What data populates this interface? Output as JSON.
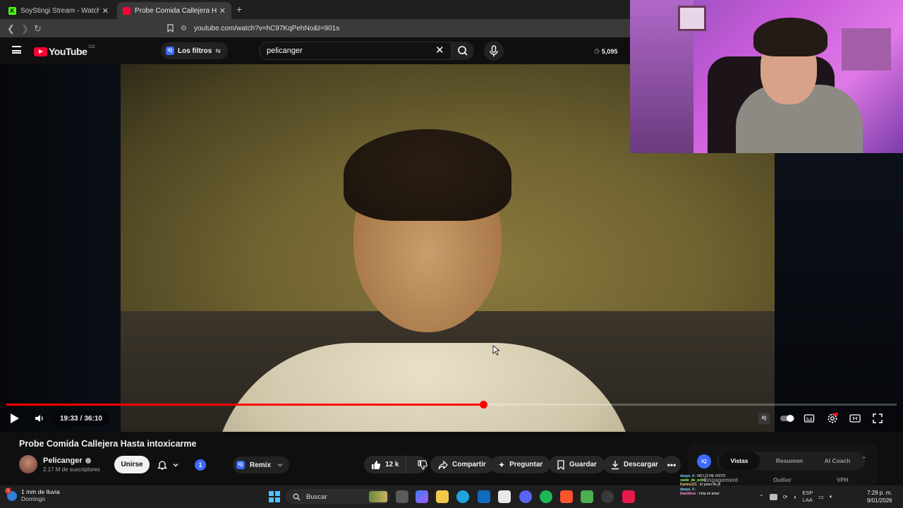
{
  "browser": {
    "tabs": [
      {
        "label": "SoyStingi Stream - Watch Live on Kick",
        "favicon": "K"
      },
      {
        "label": "Probe Comida Callejera Hasta intoxicarme"
      }
    ],
    "new_tab": "+",
    "url": "youtube.com/watch?v=hC97KqPehNo&t=901s"
  },
  "youtube": {
    "logo_text": "YouTube",
    "logo_region": "CO",
    "filters_label": "Los filtros",
    "filters_badge": "IQ",
    "search_value": "pelicanger",
    "view_count": "5,095"
  },
  "player": {
    "progress_fraction": 0.536,
    "current_time": "19:33",
    "separator": "/",
    "duration": "36:10"
  },
  "video_info": {
    "title": "Probe Comida Callejera Hasta intoxicarme",
    "channel_name": "Pelicanger",
    "subscribers": "2.17 M de suscriptores",
    "join_label": "Unirse",
    "notif_count": "1",
    "remix_label": "Remix",
    "remix_badge": "IQ",
    "likes": "12 k",
    "share_label": "Compartir",
    "ask_label": "Preguntar",
    "save_label": "Guardar",
    "download_label": "Descargar",
    "more_label": "•••"
  },
  "iq_panel": {
    "logo": "IQ",
    "tabs": [
      "Vistas",
      "Resumen",
      "AI Coach"
    ],
    "active_tab": "Vistas",
    "columns": [
      "Engagement",
      "Outlier",
      "VPH"
    ]
  },
  "chat": [
    {
      "user": "daaya_4 :",
      "msg": "NO LO HE VISTO"
    },
    {
      "user": "valde_de_pollo :",
      "msg": ""
    },
    {
      "user": "Darkis221 :",
      "msg": "El pene de jh"
    },
    {
      "user": "daaya_4 :",
      "msg": ""
    },
    {
      "user": "Davidlzzz :",
      "msg": "hola mi amor"
    }
  ],
  "taskbar": {
    "weather_line1": "1 mm de lluvia",
    "weather_line2": "Domingo",
    "weather_badge": "1",
    "search_label": "Buscar",
    "lang_line1": "ESP",
    "lang_line2": "LAA",
    "time": "7:29 p. m.",
    "date": "9/01/2026"
  },
  "colors": {
    "yt_red": "#ff0033",
    "progress_red": "#ff0000",
    "iq_blue": "#3d6bff",
    "kick_green": "#53fc18"
  }
}
